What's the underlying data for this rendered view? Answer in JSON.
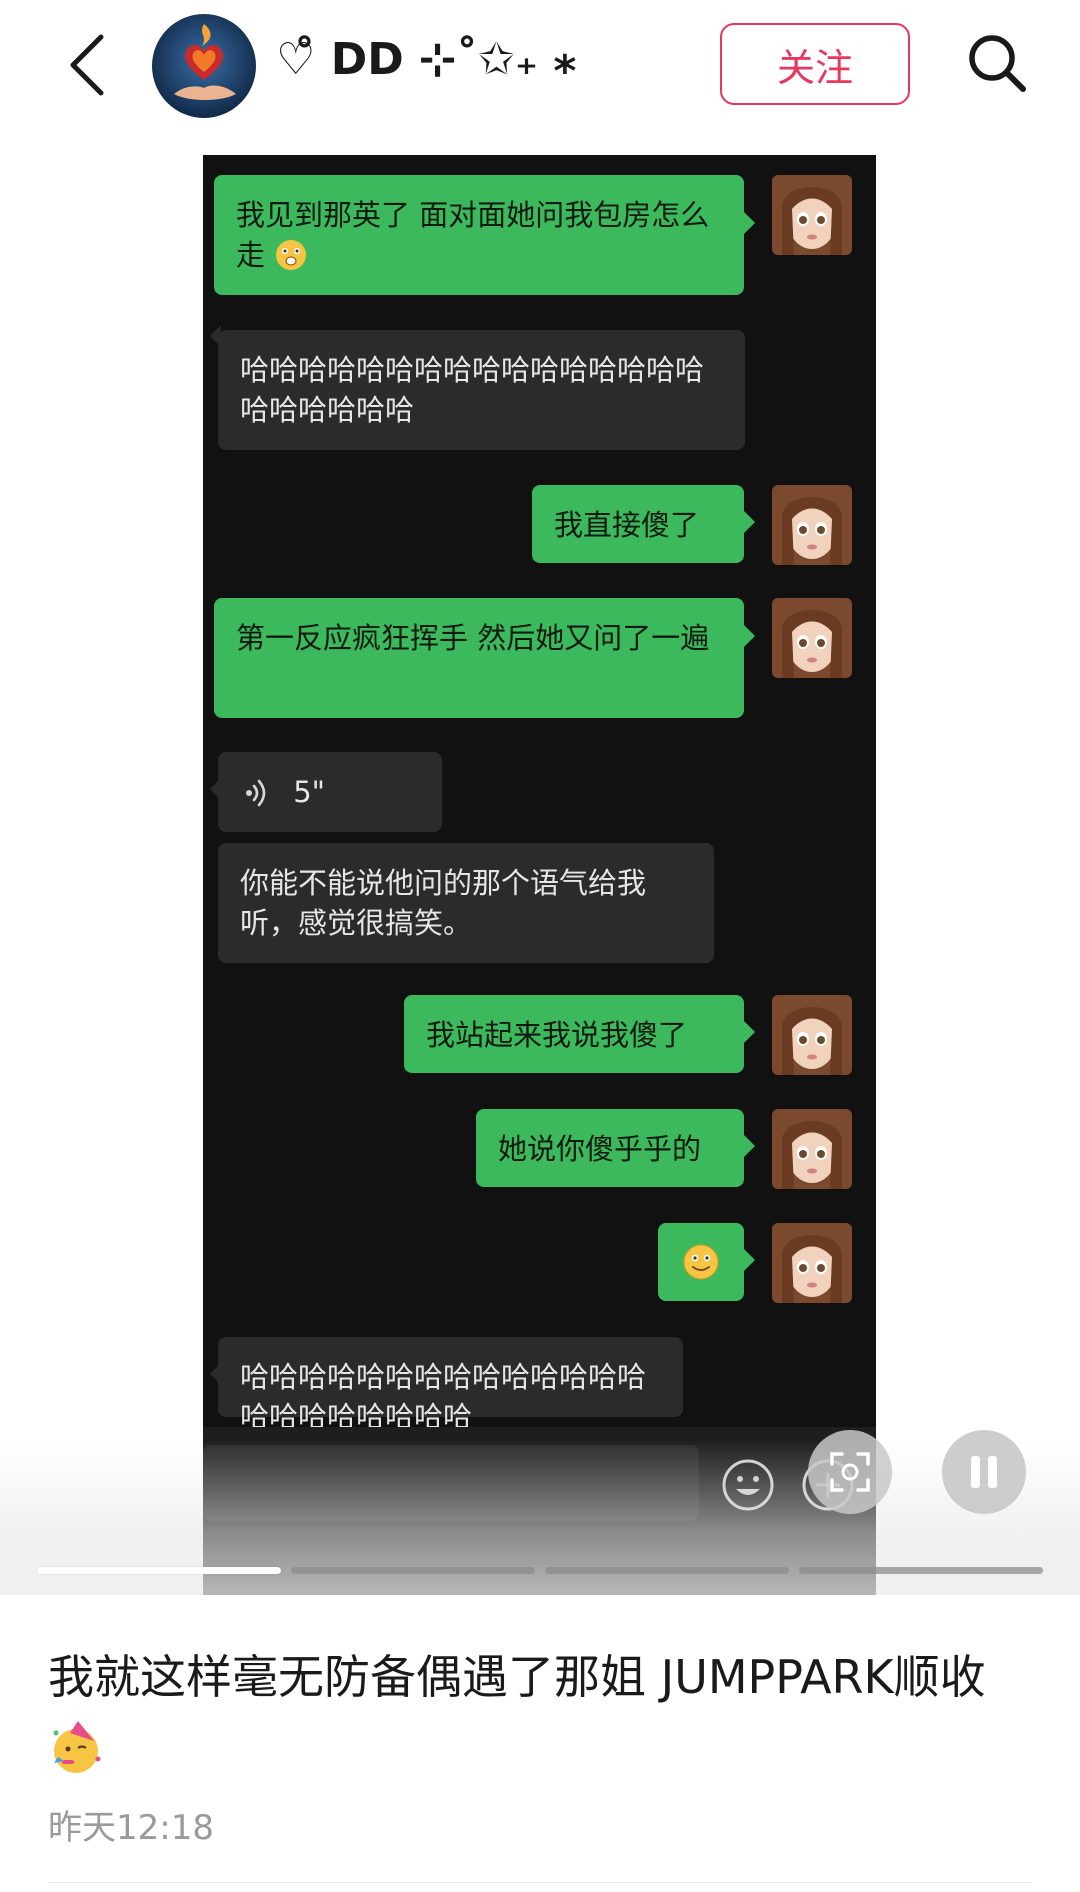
{
  "header": {
    "author_name": "♡̊ DD ⊹˚✩₊ ⁎",
    "follow_label": "关注",
    "icons": {
      "back": "back-chevron-icon",
      "search": "search-icon",
      "avatar": "flaming-heart-avatar"
    }
  },
  "chat": {
    "messages": [
      {
        "side": "sent",
        "text": "我见到那英了 面对面她问我包房怎么走",
        "emoji": "grimace-emoji"
      },
      {
        "side": "recv",
        "text": "哈哈哈哈哈哈哈哈哈哈哈哈哈哈哈哈哈哈哈哈哈哈"
      },
      {
        "side": "sent",
        "text": "我直接傻了"
      },
      {
        "side": "sent",
        "text": "第一反应疯狂挥手 然后她又问了一遍"
      },
      {
        "side": "recv",
        "type": "voice",
        "duration": "5\""
      },
      {
        "side": "recv",
        "text": "你能不能说他问的那个语气给我听，感觉很搞笑。"
      },
      {
        "side": "sent",
        "text": "我站起来我说我傻了"
      },
      {
        "side": "sent",
        "text": "她说你傻乎乎的"
      },
      {
        "side": "sent",
        "type": "emoji",
        "emoji": "smile-emoji"
      },
      {
        "side": "recv",
        "text": "哈哈哈哈哈哈哈哈哈哈哈哈哈哈哈哈哈哈哈哈哈哈"
      }
    ],
    "input_bar_icons": [
      "emoji-face-icon",
      "plus-icon"
    ],
    "colors": {
      "background": "#111111",
      "sent_bubble": "#3cb95d",
      "recv_bubble": "#2b2b2b"
    }
  },
  "player": {
    "controls": [
      "scan-icon",
      "pause-icon"
    ],
    "progress_segments": 4,
    "active_segment": 1
  },
  "post": {
    "caption": "我就这样毫无防备偶遇了那姐 JUMPPARK顺收",
    "caption_emoji": "party-face-emoji",
    "timestamp": "昨天12:18"
  }
}
